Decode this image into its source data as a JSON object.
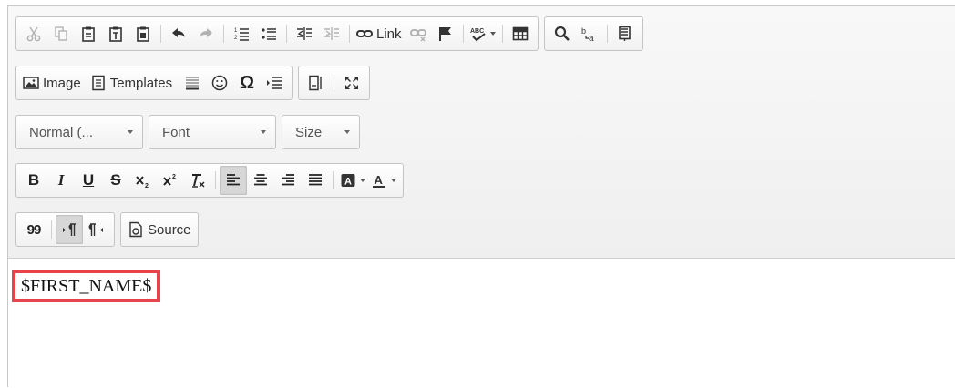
{
  "toolbar": {
    "link_label": "Link",
    "image_label": "Image",
    "templates_label": "Templates",
    "omega_symbol": "Ω",
    "format_value": "Normal (...",
    "font_value": "Font",
    "size_value": "Size",
    "bold_glyph": "B",
    "italic_glyph": "I",
    "underline_glyph": "U",
    "strike_glyph": "S",
    "source_label": "Source",
    "blockquote_glyph": "99"
  },
  "content": {
    "variable_text": "$FIRST_NAME$"
  }
}
